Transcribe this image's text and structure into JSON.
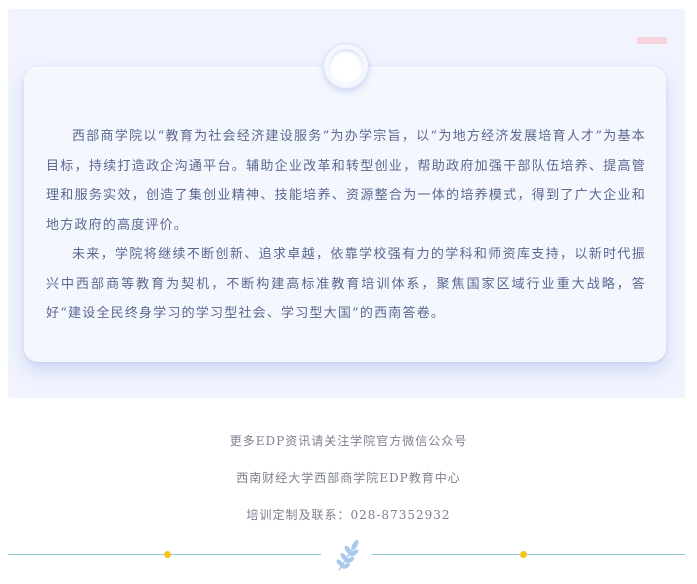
{
  "article": {
    "paragraphs": [
      "西部商学院以“教育为社会经济建设服务”为办学宗旨，以“为地方经济发展培育人才”为基本目标，持续打造政企沟通平台。辅助企业改革和转型创业，帮助政府加强干部队伍培养、提高管理和服务实效，创造了集创业精神、技能培养、资源整合为一体的培养模式，得到了广大企业和地方政府的高度评价。",
      "未来，学院将继续不断创新、追求卓越，依靠学校强有力的学科和师资库支持，以新时代振兴中西部商等教育为契机，不断构建高标准教育培训体系，聚焦国家区域行业重大战略，答好“建设全民终身学习的学习型社会、学习型大国”的西南答卷。"
    ]
  },
  "footer": {
    "line1": "更多EDP资讯请关注学院官方微信公众号",
    "line2": "西南财经大学西部商学院EDP教育中心",
    "line3": "培训定制及联系：028-87352932"
  },
  "colors": {
    "panel_bg": "#f1f4fe",
    "text": "#5a6890",
    "accent_pink": "#f8d3dc",
    "divider": "#8ec8d8",
    "dot": "#f5c518",
    "leaf": "#a9c9ec"
  },
  "icons": {
    "divider_ornament": "leaf-icon"
  }
}
